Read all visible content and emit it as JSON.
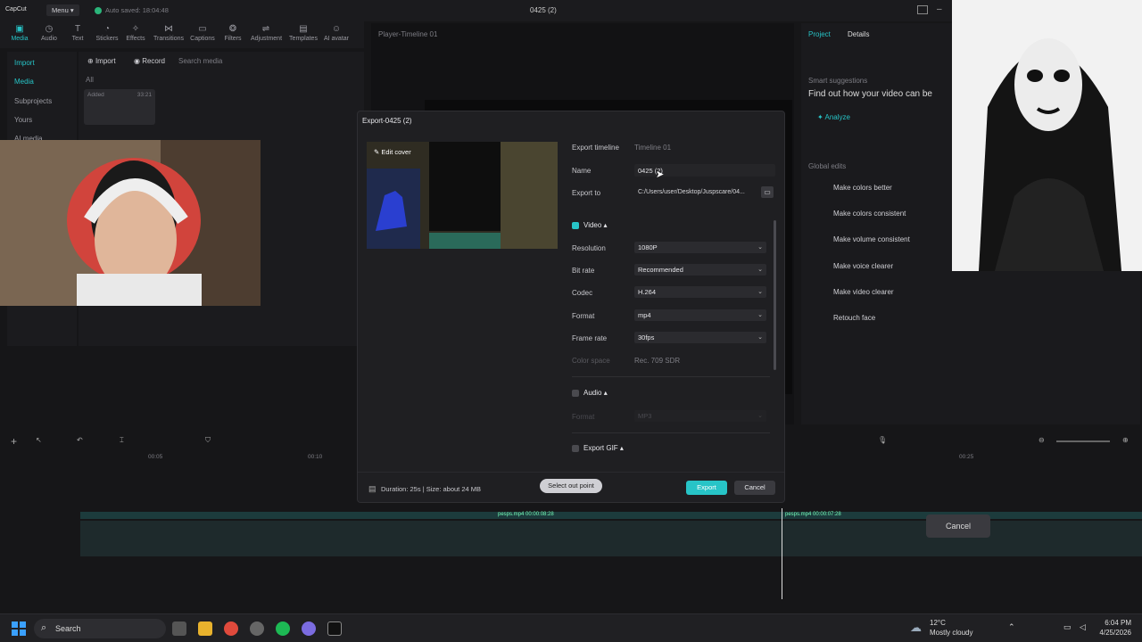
{
  "app": {
    "logo": "CapCut",
    "menu_label": "Menu",
    "autosave": "Auto saved: 18:04:48",
    "window_title": "0425 (2)"
  },
  "toolbar": {
    "items": [
      {
        "label": "Media",
        "icon": "media-icon"
      },
      {
        "label": "Audio",
        "icon": "audio-icon"
      },
      {
        "label": "Text",
        "icon": "text-icon"
      },
      {
        "label": "Stickers",
        "icon": "sticker-icon"
      },
      {
        "label": "Effects",
        "icon": "effects-icon"
      },
      {
        "label": "Transitions",
        "icon": "transition-icon"
      },
      {
        "label": "Captions",
        "icon": "captions-icon"
      },
      {
        "label": "Filters",
        "icon": "filter-icon"
      },
      {
        "label": "Adjustment",
        "icon": "adjust-icon"
      },
      {
        "label": "Templates",
        "icon": "template-icon"
      },
      {
        "label": "AI avatar",
        "icon": "avatar-icon"
      }
    ]
  },
  "leftnav": {
    "items": [
      "Import",
      "Media",
      "Subprojects",
      "Yours",
      "AI media"
    ]
  },
  "mediapane": {
    "import_label": "Import",
    "record_label": "Record",
    "search_placeholder": "Search media",
    "filter_all": "All",
    "clip_added": "Added",
    "clip_duration": "33:21"
  },
  "player": {
    "title": "Player-Timeline 01"
  },
  "rightpane": {
    "tabs": [
      "Project",
      "Details"
    ],
    "smart_title": "Smart suggestions",
    "smart_text": "Find out how your video can be",
    "analyze_label": "Analyze",
    "global_title": "Global edits",
    "edits": [
      "Make colors better",
      "Make colors consistent",
      "Make volume consistent",
      "Make voice clearer",
      "Make video clearer",
      "Retouch face"
    ]
  },
  "dialog": {
    "title": "Export-0425 (2)",
    "edit_cover": "Edit cover",
    "export_timeline_label": "Export timeline",
    "export_timeline_value": "Timeline 01",
    "name_label": "Name",
    "name_value": "0425 (2)",
    "export_to_label": "Export to",
    "export_to_value": "C:/Users/user/Desktop/Juspscare/04...",
    "video_section": "Video",
    "rows": [
      {
        "label": "Resolution",
        "value": "1080P"
      },
      {
        "label": "Bit rate",
        "value": "Recommended"
      },
      {
        "label": "Codec",
        "value": "H.264"
      },
      {
        "label": "Format",
        "value": "mp4"
      },
      {
        "label": "Frame rate",
        "value": "30fps"
      }
    ],
    "color_space_label": "Color space",
    "color_space_value": "Rec. 709 SDR",
    "audio_section": "Audio",
    "audio_format_label": "Format",
    "audio_format_value": "MP3",
    "gif_section": "Export GIF",
    "duration_text": "Duration: 25s | Size: about 24 MB",
    "select_out_point": "Select out point",
    "export_button": "Export",
    "cancel_button": "Cancel"
  },
  "timeline": {
    "ticks": [
      "00:05",
      "00:10",
      "00:15",
      "00:20",
      "00:25"
    ],
    "clip1": "pesps.mp4  00:00:08:28",
    "clip2": "pesps.mp4  00:00:07:28",
    "cancel_overlay": "Cancel"
  },
  "taskbar": {
    "search_label": "Search",
    "weather_temp": "12°C",
    "weather_desc": "Mostly cloudy",
    "time": "6:04 PM",
    "date": "4/25/2026"
  },
  "colors": {
    "accent": "#27c4c7",
    "dialog_bg": "#1f1f22",
    "app_bg": "#161618",
    "select_bg": "#2b2b2f"
  }
}
